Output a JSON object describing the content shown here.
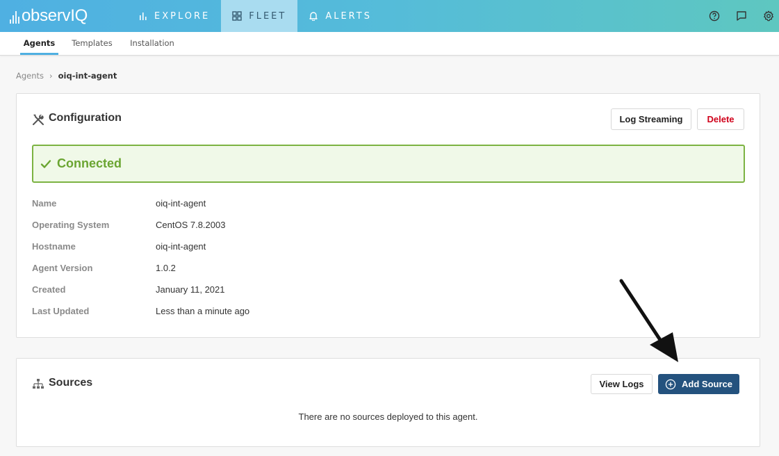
{
  "app": {
    "logo_text": "observIQ",
    "nav": [
      {
        "label": "EXPLORE",
        "icon": "bar-chart-icon"
      },
      {
        "label": "FLEET",
        "icon": "grid-icon"
      },
      {
        "label": "ALERTS",
        "icon": "bell-icon"
      }
    ],
    "active_nav": "FLEET",
    "right_icons": [
      "help-icon",
      "chat-icon",
      "gear-icon"
    ],
    "brand_colors": {
      "gradient_start": "#4fb0e2",
      "gradient_end": "#5ec7c0",
      "active_tab_bg": "#a9dcf0"
    }
  },
  "subtabs": [
    {
      "label": "Agents",
      "active": true
    },
    {
      "label": "Templates",
      "active": false
    },
    {
      "label": "Installation",
      "active": false
    }
  ],
  "breadcrumb": {
    "parent": "Agents",
    "separator": "›",
    "current": "oiq-int-agent"
  },
  "configuration": {
    "title": "Configuration",
    "icon": "tools-icon",
    "buttons": {
      "log_streaming": "Log Streaming",
      "delete": "Delete"
    },
    "status": {
      "label": "Connected",
      "color": "#6aa531"
    },
    "details": [
      {
        "key": "Name",
        "value": "oiq-int-agent"
      },
      {
        "key": "Operating System",
        "value": "CentOS 7.8.2003"
      },
      {
        "key": "Hostname",
        "value": "oiq-int-agent"
      },
      {
        "key": "Agent Version",
        "value": "1.0.2"
      },
      {
        "key": "Created",
        "value": "January 11, 2021"
      },
      {
        "key": "Last Updated",
        "value": "Less than a minute ago"
      }
    ]
  },
  "sources": {
    "title": "Sources",
    "icon": "sitemap-icon",
    "buttons": {
      "view_logs": "View Logs",
      "add_source": "Add Source"
    },
    "empty_message": "There are no sources deployed to this agent."
  }
}
